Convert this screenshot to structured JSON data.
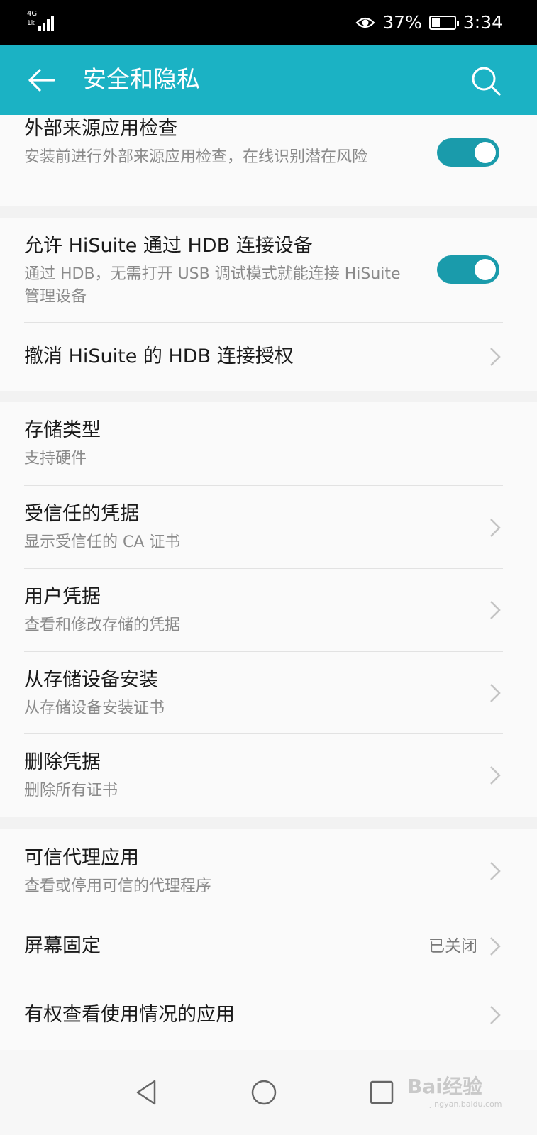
{
  "status_bar": {
    "network": "4G",
    "network_sub": "1k",
    "battery_percent": "37%",
    "time": "3:34",
    "battery_level": 0.37
  },
  "app_bar": {
    "title": "安全和隐私",
    "back_icon": "arrow-left-icon",
    "search_icon": "search-icon",
    "background_color": "#1bb2c4"
  },
  "sections": {
    "external_check": {
      "title": "外部来源应用检查",
      "subtitle": "安装前进行外部来源应用检查，在线识别潜在风险",
      "toggle_on": true
    },
    "hdb": {
      "allow_title": "允许 HiSuite 通过 HDB 连接设备",
      "allow_subtitle": "通过 HDB，无需打开 USB 调试模式就能连接 HiSuite 管理设备",
      "allow_toggle_on": true,
      "revoke_title": "撤消 HiSuite 的 HDB 连接授权"
    },
    "credentials": {
      "storage_type_title": "存储类型",
      "storage_type_sub": "支持硬件",
      "trusted_title": "受信任的凭据",
      "trusted_sub": "显示受信任的 CA 证书",
      "user_title": "用户凭据",
      "user_sub": "查看和修改存储的凭据",
      "install_title": "从存储设备安装",
      "install_sub": "从存储设备安装证书",
      "delete_title": "删除凭据",
      "delete_sub": "删除所有证书"
    },
    "advanced": {
      "trust_agents_title": "可信代理应用",
      "trust_agents_sub": "查看或停用可信的代理程序",
      "screen_pin_title": "屏幕固定",
      "screen_pin_value": "已关闭",
      "usage_access_title": "有权查看使用情况的应用"
    }
  },
  "nav_bar": {
    "back": "triangle-back-icon",
    "home": "circle-home-icon",
    "recents": "square-recents-icon"
  },
  "watermark": {
    "logo": "Bai经验",
    "sub": "jingyan.baidu.com"
  },
  "colors": {
    "accent": "#1bb2c4",
    "toggle": "#1a9bab"
  }
}
